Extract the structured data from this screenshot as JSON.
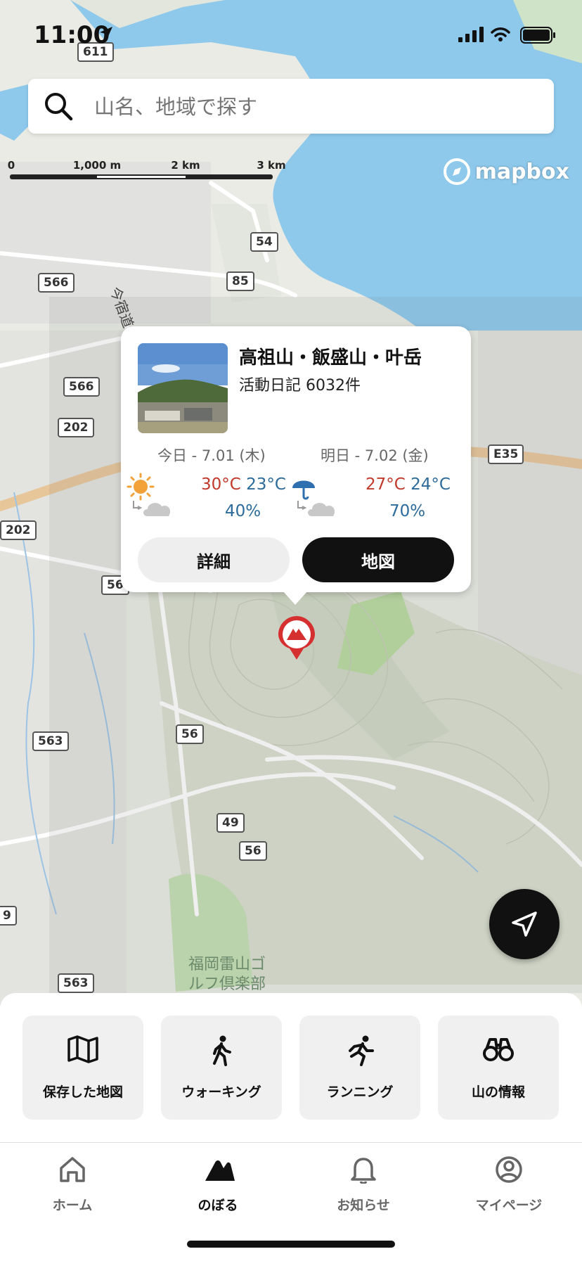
{
  "status_bar": {
    "time": "11:00"
  },
  "search": {
    "placeholder": "山名、地域で探す"
  },
  "scale": {
    "labels": [
      "0",
      "1,000 m",
      "2 km",
      "3 km"
    ]
  },
  "attribution": {
    "text": "mapbox"
  },
  "map_labels": {
    "routes": [
      "611",
      "54",
      "85",
      "566",
      "566",
      "202",
      "202",
      "56",
      "E35",
      "563",
      "56",
      "49",
      "56",
      "9",
      "563"
    ],
    "road_name": "今宿道",
    "poi": "福岡雷山ゴルフ倶楽部"
  },
  "popup": {
    "title": "高祖山・飯盛山・叶岳",
    "subtitle": "活動日記 6032件",
    "today": {
      "label": "今日 - 7.01 (木)",
      "high": "30°C",
      "low": "23°C",
      "precip": "40%",
      "icon": "sun-to-cloud-icon"
    },
    "tomorrow": {
      "label": "明日 - 7.02 (金)",
      "high": "27°C",
      "low": "24°C",
      "precip": "70%",
      "icon": "umbrella-to-cloud-icon"
    },
    "detail_button": "詳細",
    "map_button": "地図"
  },
  "quick_actions": [
    {
      "label": "保存した地図",
      "icon": "map-icon"
    },
    {
      "label": "ウォーキング",
      "icon": "walking-icon"
    },
    {
      "label": "ランニング",
      "icon": "running-icon"
    },
    {
      "label": "山の情報",
      "icon": "binoculars-icon"
    }
  ],
  "tabs": [
    {
      "label": "ホーム",
      "icon": "home-icon",
      "active": false
    },
    {
      "label": "のぼる",
      "icon": "mountain-icon",
      "active": true
    },
    {
      "label": "お知らせ",
      "icon": "bell-icon",
      "active": false
    },
    {
      "label": "マイページ",
      "icon": "profile-icon",
      "active": false
    }
  ],
  "colors": {
    "accent": "#111111",
    "temp_high": "#c0392b",
    "temp_low": "#2c6b9a",
    "pin": "#d62f2f",
    "water": "#8ec9ec"
  }
}
